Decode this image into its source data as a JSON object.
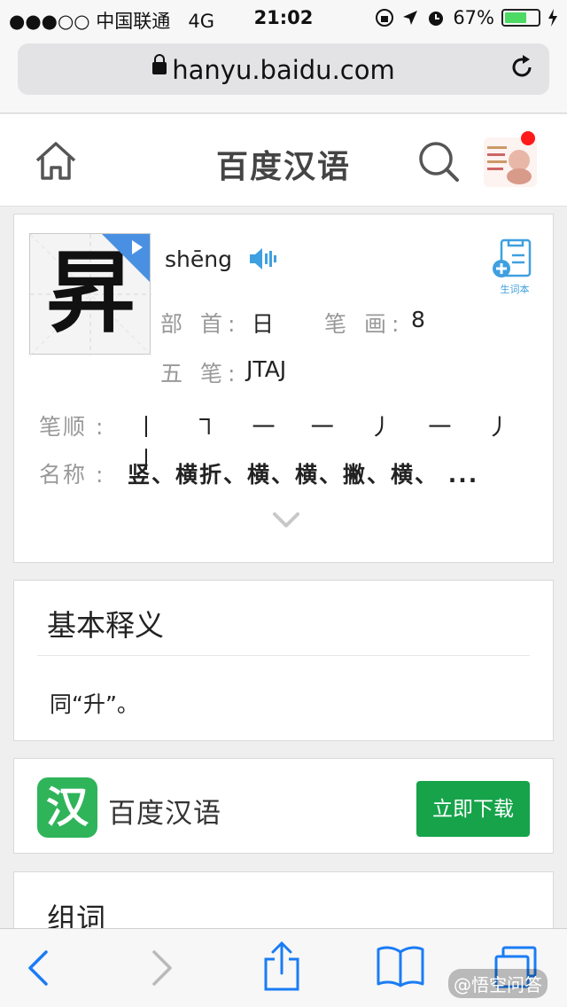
{
  "status": {
    "carrier": "●●●○○ 中国联通",
    "network": "4G",
    "time": "21:02",
    "battery_text": "67%",
    "battery_level": 0.67
  },
  "browser": {
    "url": "hanyu.baidu.com"
  },
  "header": {
    "title": "百度汉语"
  },
  "word": {
    "character": "昇",
    "pinyin": "shēng",
    "vocab_label": "生词本",
    "radical_label": "部 首:",
    "radical_value": "日",
    "strokes_label": "笔 画:",
    "strokes_value": "8",
    "wubi_label": "五 笔:",
    "wubi_value": "JTAJ",
    "order_label": "笔顺 :",
    "order_value": "丨 ㇕ 一 一 丿 一 丿 丨",
    "names_label": "名称 :",
    "names_value": "竖、横折、横、横、撇、横、 ..."
  },
  "definition": {
    "heading": "基本释义",
    "text": "同“升”。"
  },
  "app": {
    "icon_char": "汉",
    "name": "百度汉语",
    "download_label": "立即下载"
  },
  "words": {
    "heading": "组词"
  },
  "watermark": "@悟空问答",
  "colors": {
    "accent_blue": "#4a90e2",
    "download_green": "#16a34a",
    "app_icon_green": "#2fb45a",
    "notification_red": "#ff1a1a"
  }
}
